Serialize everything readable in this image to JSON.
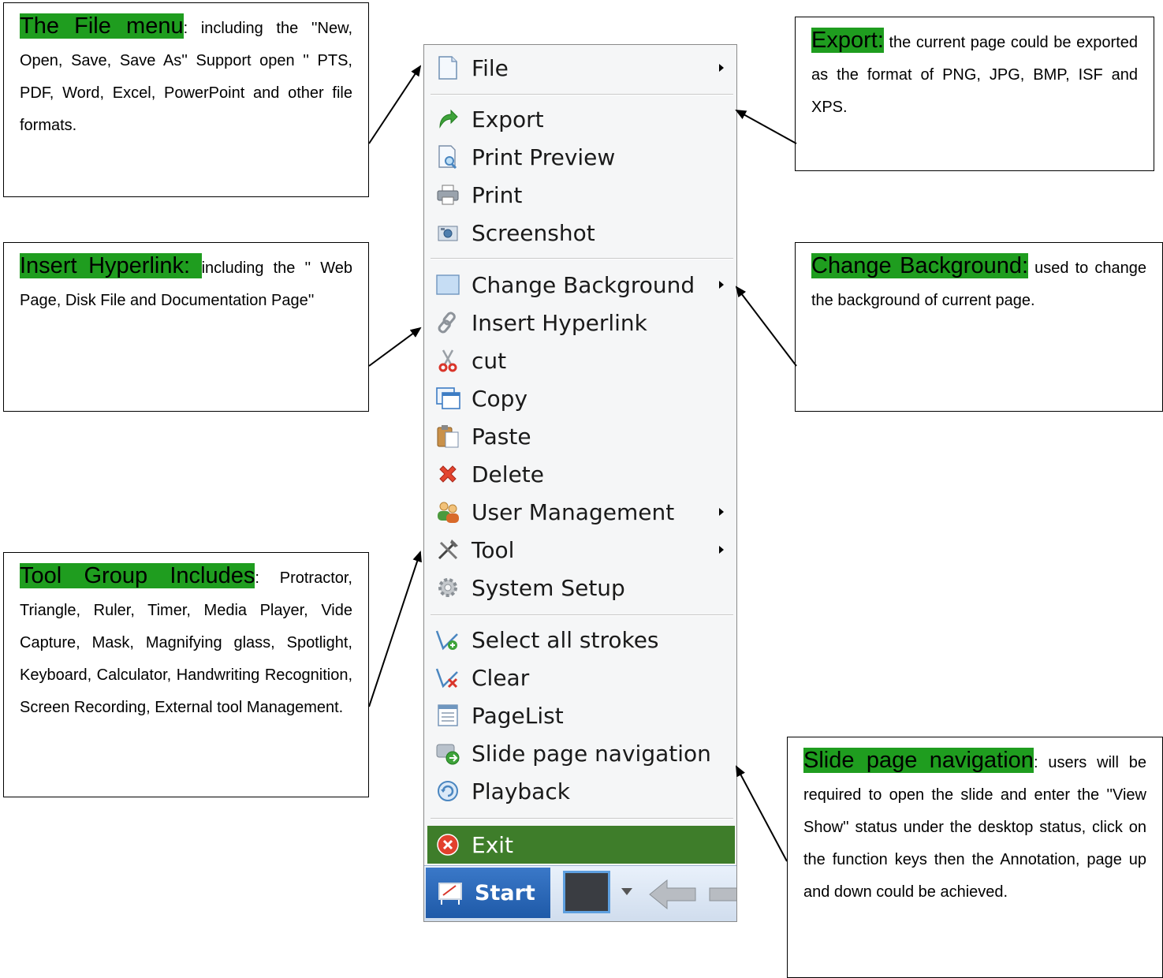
{
  "callouts": {
    "file": {
      "title": "The File menu",
      "body": ": including the ''New, Open, Save, Save As'' Support open '' PTS, PDF, Word, Excel, PowerPoint and other file formats."
    },
    "hyperlink": {
      "title": "Insert Hyperlink: ",
      "body": "including the '' Web Page, Disk File and Documentation Page''"
    },
    "tool": {
      "title": "Tool Group Includes",
      "body": ": Protractor, Triangle, Ruler, Timer, Media Player, Vide Capture, Mask, Magnifying glass, Spotlight, Keyboard, Calculator, Handwriting Recognition, Screen Recording, External tool Management."
    },
    "export": {
      "title": "Export:",
      "body": " the current page could be exported as the format of PNG, JPG, BMP, ISF and XPS."
    },
    "background": {
      "title": "Change Background:",
      "body": " used to change the background of current page."
    },
    "slide": {
      "title": "Slide page navigation",
      "body": ": users will be required to open the slide and enter the ''View Show'' status under the desktop status, click on the function keys then the Annotation, page up and down could be achieved."
    }
  },
  "menu": {
    "items": [
      {
        "label": "File"
      },
      {
        "label": "Export"
      },
      {
        "label": "Print Preview"
      },
      {
        "label": "Print"
      },
      {
        "label": "Screenshot"
      },
      {
        "label": "Change Background"
      },
      {
        "label": "Insert Hyperlink"
      },
      {
        "label": "cut"
      },
      {
        "label": "Copy"
      },
      {
        "label": "Paste"
      },
      {
        "label": "Delete"
      },
      {
        "label": "User Management"
      },
      {
        "label": "Tool"
      },
      {
        "label": "System Setup"
      },
      {
        "label": "Select all strokes"
      },
      {
        "label": "Clear"
      },
      {
        "label": "PageList"
      },
      {
        "label": "Slide page navigation"
      },
      {
        "label": "Playback"
      }
    ],
    "exit_label": "Exit"
  },
  "taskbar": {
    "start_label": "Start"
  },
  "colors": {
    "highlight": "#1f9d1f",
    "exit_bg": "#3e7d2a",
    "start_bg": "#2a66b8"
  }
}
